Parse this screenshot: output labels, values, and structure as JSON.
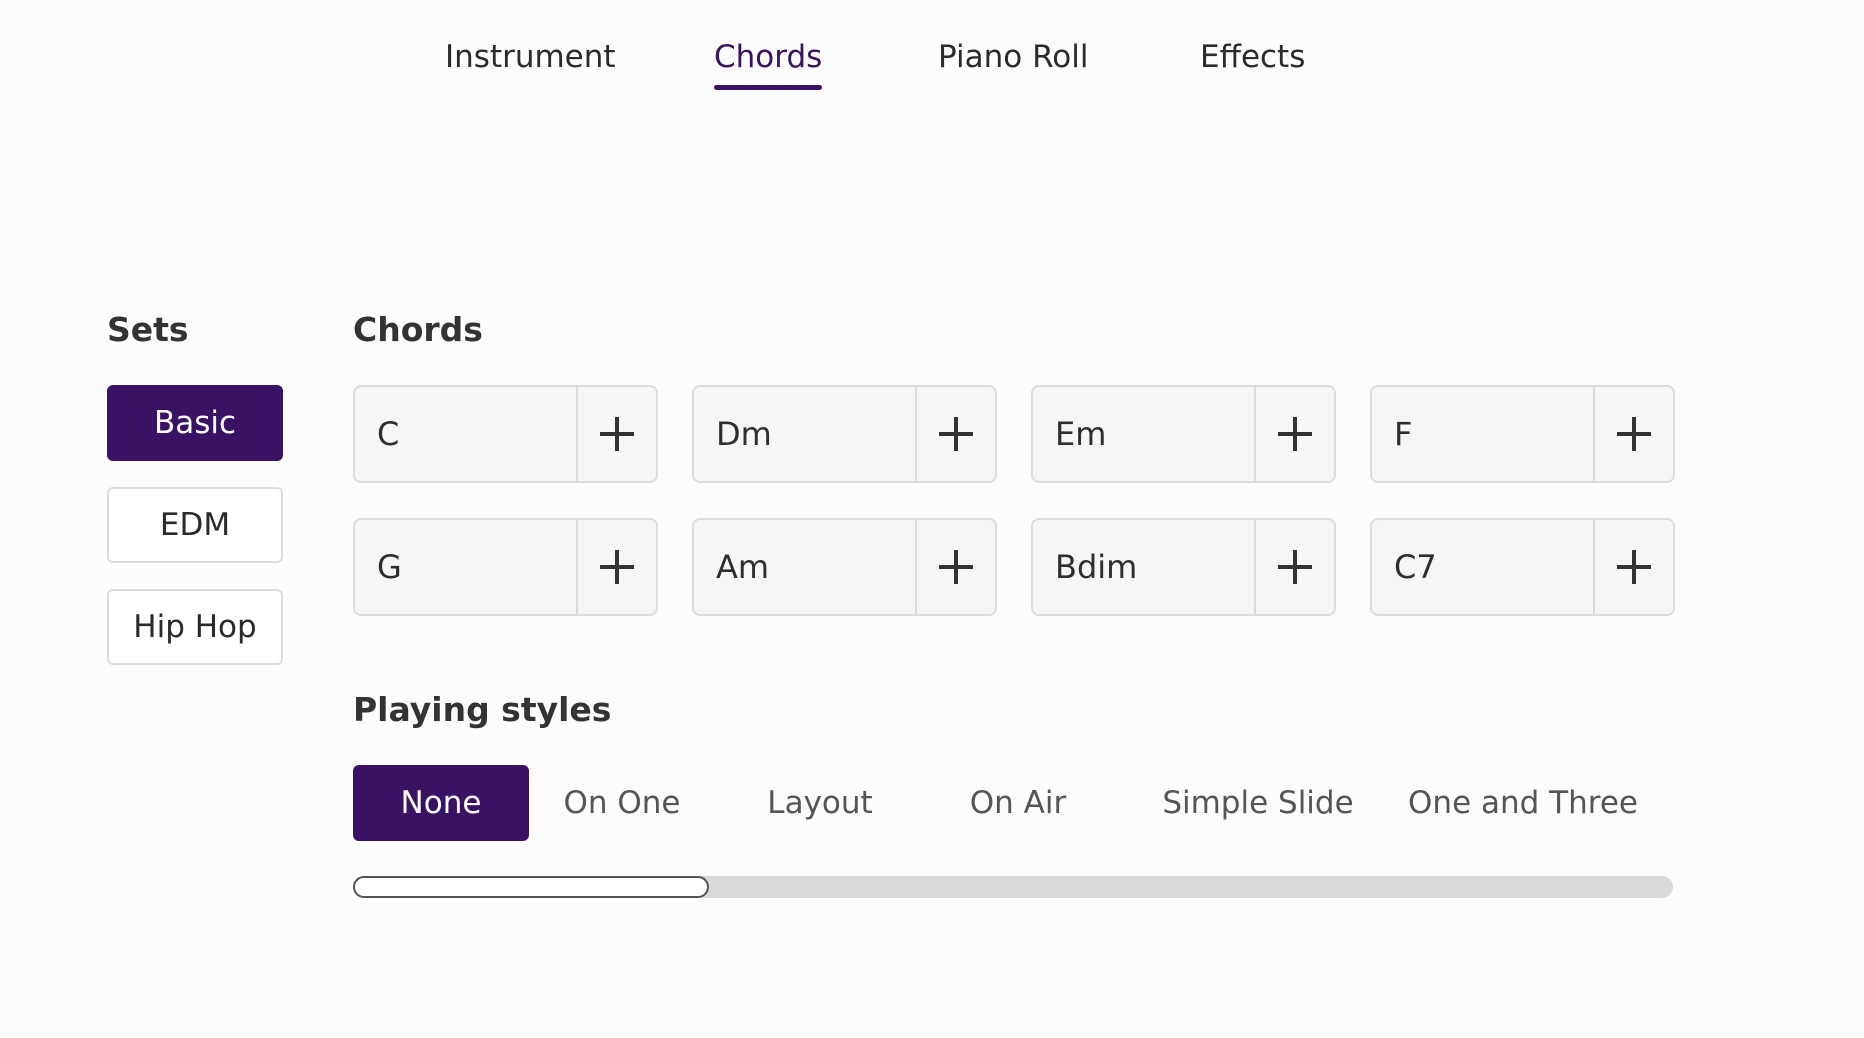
{
  "tabs": [
    {
      "label": "Instrument",
      "active": false
    },
    {
      "label": "Chords",
      "active": true
    },
    {
      "label": "Piano Roll",
      "active": false
    },
    {
      "label": "Effects",
      "active": false
    }
  ],
  "sets": {
    "heading": "Sets",
    "items": [
      {
        "label": "Basic",
        "active": true
      },
      {
        "label": "EDM",
        "active": false
      },
      {
        "label": "Hip Hop",
        "active": false
      }
    ]
  },
  "chords": {
    "heading": "Chords",
    "items": [
      "C",
      "Dm",
      "Em",
      "F",
      "G",
      "Am",
      "Bdim",
      "C7"
    ],
    "add_icon": "plus-icon"
  },
  "playing_styles": {
    "heading": "Playing styles",
    "items": [
      {
        "label": "None",
        "active": true
      },
      {
        "label": "On One",
        "active": false
      },
      {
        "label": "Layout",
        "active": false
      },
      {
        "label": "On Air",
        "active": false
      },
      {
        "label": "Simple Slide",
        "active": false
      },
      {
        "label": "One and Three",
        "active": false
      }
    ],
    "scroll_fraction": 0.27
  },
  "colors": {
    "accent": "#3a1263",
    "border": "#dcdcdc",
    "background": "#fcfcfc"
  }
}
